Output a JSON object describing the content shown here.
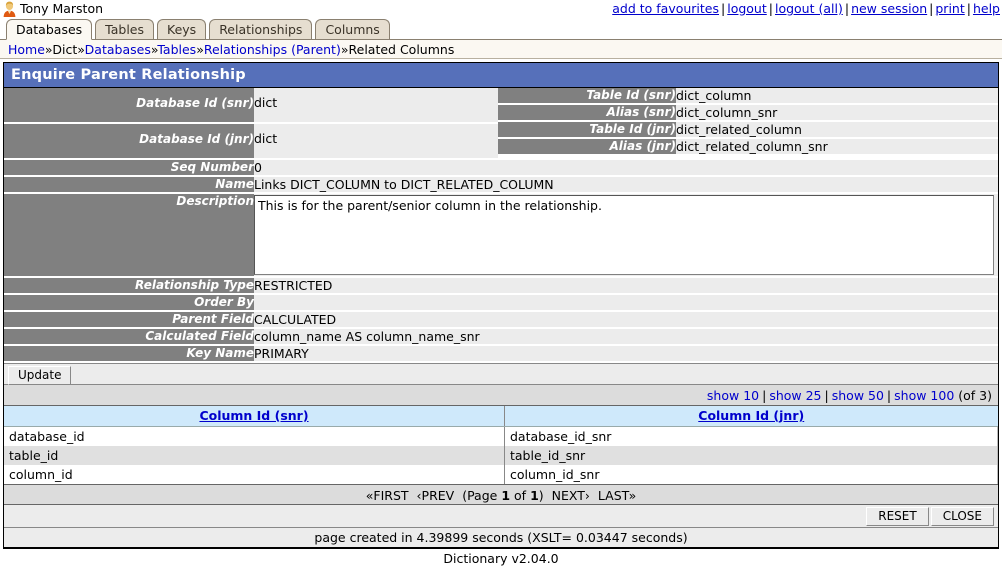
{
  "header": {
    "user_icon": "user-avatar-icon",
    "user_name": "Tony Marston",
    "links": [
      {
        "label": "add to favourites"
      },
      {
        "label": "logout"
      },
      {
        "label": "logout (all)"
      },
      {
        "label": "new session"
      },
      {
        "label": "print"
      },
      {
        "label": "help"
      }
    ],
    "separator": "|"
  },
  "tabs": [
    {
      "label": "Databases",
      "active": true
    },
    {
      "label": "Tables",
      "active": false
    },
    {
      "label": "Keys",
      "active": false
    },
    {
      "label": "Relationships",
      "active": false
    },
    {
      "label": "Columns",
      "active": false
    }
  ],
  "breadcrumb": {
    "separator": "»",
    "items": [
      {
        "label": "Home",
        "link": true
      },
      {
        "label": "Dict",
        "link": false
      },
      {
        "label": "Databases",
        "link": true
      },
      {
        "label": "Tables",
        "link": true
      },
      {
        "label": "Relationships (Parent)",
        "link": true
      },
      {
        "label": "Related Columns",
        "link": false
      }
    ]
  },
  "panel": {
    "title": "Enquire Parent Relationship"
  },
  "form": {
    "left": [
      {
        "label": "Database Id (snr)",
        "value": "dict",
        "tall": true
      },
      {
        "label": "Database Id (jnr)",
        "value": "dict",
        "tall": true
      },
      {
        "label": "Seq Number",
        "value": "0",
        "tall": false
      },
      {
        "label": "Name",
        "value": "Links DICT_COLUMN to DICT_RELATED_COLUMN",
        "tall": false
      }
    ],
    "right": [
      {
        "label": "Table Id (snr)",
        "value": "dict_column"
      },
      {
        "label": "Alias (snr)",
        "value": "dict_column_snr"
      },
      {
        "label": "Table Id (jnr)",
        "value": "dict_related_column"
      },
      {
        "label": "Alias (jnr)",
        "value": "dict_related_column_snr"
      }
    ],
    "description": {
      "label": "Description",
      "value": "This is for the parent/senior column in the relationship."
    },
    "bottom": [
      {
        "label": "Relationship Type",
        "value": "RESTRICTED"
      },
      {
        "label": "Order By",
        "value": ""
      },
      {
        "label": "Parent Field",
        "value": "CALCULATED"
      },
      {
        "label": "Calculated Field",
        "value": "column_name AS column_name_snr"
      },
      {
        "label": "Key Name",
        "value": "PRIMARY"
      }
    ],
    "update_button": "Update"
  },
  "show_bar": {
    "options": [
      "show 10",
      "show 25",
      "show 50",
      "show 100"
    ],
    "separator": "|",
    "count_label": "(of 3)"
  },
  "grid": {
    "columns": [
      "Column Id (snr)",
      "Column Id (jnr)"
    ],
    "rows": [
      [
        "database_id",
        "database_id_snr"
      ],
      [
        "table_id",
        "table_id_snr"
      ],
      [
        "column_id",
        "column_id_snr"
      ]
    ]
  },
  "pager": {
    "first": "«FIRST",
    "prev": "‹PREV",
    "page_prefix": "(Page",
    "page_current": "1",
    "page_of": "of",
    "page_total": "1",
    "page_suffix": ")",
    "next": "NEXT›",
    "last": "LAST»"
  },
  "bottom_buttons": {
    "reset": "RESET",
    "close": "CLOSE"
  },
  "footer": {
    "timing": "page created in 4.39899 seconds (XSLT= 0.03447 seconds)",
    "version": "Dictionary v2.04.0"
  }
}
